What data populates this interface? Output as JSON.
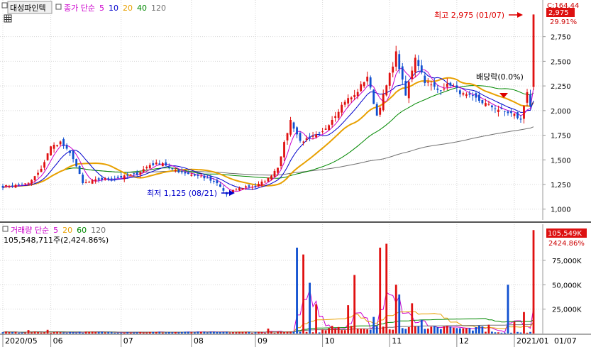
{
  "header": {
    "stock_name": "대성파인텍",
    "price_legend": {
      "label": "종가 단순",
      "periods": [
        "5",
        "10",
        "20",
        "40",
        "120"
      ],
      "colors": [
        "#cc00cc",
        "#0000cc",
        "#e8a000",
        "#008800",
        "#707070"
      ]
    },
    "volume_legend": {
      "label": "거래량 단순",
      "periods": [
        "5",
        "20",
        "60",
        "120"
      ],
      "colors": [
        "#cc00cc",
        "#e8a000",
        "#008800",
        "#707070"
      ],
      "summary": "105,548,711주(2,424.86%)"
    }
  },
  "price_box": {
    "corner": "C:164.44",
    "value": "2,975",
    "pct": "29.91%"
  },
  "volume_box": {
    "value": "105,549K",
    "pct": "2424.86%"
  },
  "annotations": {
    "high": "최고 2,975 (01/07)",
    "low": "최저 1,125 (08/21)",
    "dividend": "배당락(0.0%)"
  },
  "chart_data": [
    {
      "type": "candlestick",
      "title": "",
      "yticks": [
        1000,
        1250,
        1500,
        1750,
        2000,
        2250,
        2500,
        2750
      ],
      "ytick_labels": [
        "1,000",
        "1,250",
        "1,500",
        "1,750",
        "2,000",
        "2,250",
        "2,500",
        "2,750"
      ],
      "ylim": [
        890,
        3050
      ],
      "x_labels": [
        "2020/05",
        "06",
        "07",
        "08",
        "09",
        "10",
        "11",
        "12",
        "2021/01",
        "01/07"
      ],
      "x_label_index": [
        0,
        15,
        37,
        59,
        79,
        100,
        121,
        142,
        160,
        172
      ],
      "n_days": 167,
      "key_points": [
        [
          0,
          1230
        ],
        [
          4,
          1240
        ],
        [
          8,
          1260
        ],
        [
          12,
          1400
        ],
        [
          14,
          1570
        ],
        [
          15,
          1630
        ],
        [
          18,
          1680
        ],
        [
          22,
          1520
        ],
        [
          25,
          1260
        ],
        [
          30,
          1300
        ],
        [
          34,
          1310
        ],
        [
          38,
          1330
        ],
        [
          42,
          1360
        ],
        [
          46,
          1450
        ],
        [
          50,
          1470
        ],
        [
          53,
          1400
        ],
        [
          58,
          1360
        ],
        [
          63,
          1320
        ],
        [
          67,
          1260
        ],
        [
          70,
          1150
        ],
        [
          73,
          1200
        ],
        [
          76,
          1230
        ],
        [
          79,
          1230
        ],
        [
          83,
          1310
        ],
        [
          86,
          1430
        ],
        [
          90,
          1900
        ],
        [
          93,
          1690
        ],
        [
          96,
          1710
        ],
        [
          100,
          1780
        ],
        [
          104,
          1960
        ],
        [
          107,
          2100
        ],
        [
          110,
          2150
        ],
        [
          114,
          2350
        ],
        [
          117,
          1950
        ],
        [
          120,
          2250
        ],
        [
          123,
          2580
        ],
        [
          126,
          2150
        ],
        [
          129,
          2550
        ],
        [
          132,
          2300
        ],
        [
          136,
          2210
        ],
        [
          140,
          2270
        ],
        [
          144,
          2160
        ],
        [
          148,
          2120
        ],
        [
          152,
          2050
        ],
        [
          156,
          2000
        ],
        [
          160,
          1960
        ],
        [
          162,
          1900
        ],
        [
          164,
          2200
        ],
        [
          165,
          2050
        ],
        [
          166,
          2250
        ],
        [
          167,
          2975
        ]
      ],
      "high": {
        "value": 2975,
        "index": 166
      },
      "low": {
        "value": 1125,
        "index": 70
      }
    },
    {
      "type": "bar",
      "title": "",
      "yticks": [
        25000,
        50000,
        75000
      ],
      "ytick_labels": [
        "25,000K",
        "50,000K",
        "75,000K"
      ],
      "ylim": [
        0,
        112000
      ],
      "spikes": [
        [
          8,
          3500
        ],
        [
          14,
          3800
        ],
        [
          83,
          5000
        ],
        [
          92,
          88000
        ],
        [
          94,
          81000
        ],
        [
          96,
          52000
        ],
        [
          98,
          30000
        ],
        [
          100,
          4000
        ],
        [
          108,
          29000
        ],
        [
          110,
          60000
        ],
        [
          116,
          17000
        ],
        [
          118,
          88000
        ],
        [
          120,
          92000
        ],
        [
          123,
          50000
        ],
        [
          124,
          40000
        ],
        [
          128,
          31000
        ],
        [
          131,
          14000
        ],
        [
          152,
          9000
        ],
        [
          158,
          50000
        ],
        [
          160,
          12000
        ],
        [
          163,
          22000
        ],
        [
          166,
          106000
        ]
      ],
      "base_volume": [
        800,
        2000
      ],
      "high_volume_range": [
        100,
        150
      ]
    }
  ]
}
